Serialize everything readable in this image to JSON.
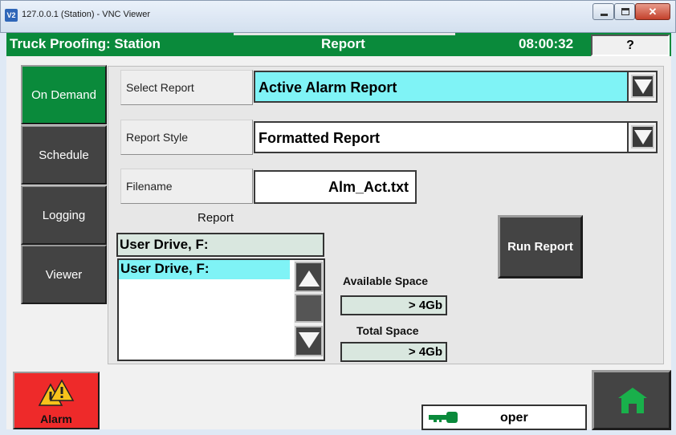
{
  "window": {
    "title": "127.0.0.1 (Station) - VNC Viewer",
    "app_icon_text": "V2"
  },
  "header": {
    "title": "Truck Proofing: Station",
    "section": "Report",
    "time": "08:00:32",
    "help_label": "?"
  },
  "nav": {
    "items": [
      {
        "label": "On Demand",
        "active": true
      },
      {
        "label": "Schedule",
        "active": false
      },
      {
        "label": "Logging",
        "active": false
      },
      {
        "label": "Viewer",
        "active": false
      }
    ]
  },
  "form": {
    "select_report_label": "Select Report",
    "select_report_value": "Active Alarm Report",
    "select_report_bg": "#7ff3f6",
    "report_style_label": "Report Style",
    "report_style_value": "Formatted Report",
    "filename_label": "Filename",
    "filename_value": "Alm_Act.txt"
  },
  "report_location": {
    "caption": "Report",
    "selected_drive": "User Drive, F:",
    "drives": [
      "User Drive, F:"
    ]
  },
  "space": {
    "available_label": "Available Space",
    "available_value": "> 4Gb",
    "total_label": "Total Space",
    "total_value": "> 4Gb"
  },
  "actions": {
    "run_report_label": "Run Report"
  },
  "footer": {
    "alarm_label": "Alarm",
    "user": "oper"
  },
  "colors": {
    "header_green": "#0a8a3b",
    "active_nav": "#0a8a3b",
    "inactive_nav": "#434343",
    "alarm_red": "#ee2a2a",
    "highlight_cyan": "#7ff3f6"
  },
  "icons": {
    "alarm": "warning-triangles-icon",
    "user": "key-icon",
    "home": "home-icon"
  }
}
